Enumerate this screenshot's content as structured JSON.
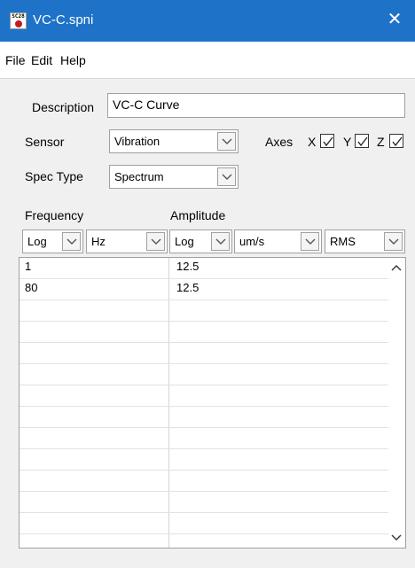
{
  "window": {
    "title": "VC-C.spni",
    "icon_label": "SC28",
    "close_glyph": "✕"
  },
  "menu": {
    "items": [
      "File",
      "Edit",
      "Help"
    ]
  },
  "form": {
    "description_label": "Description",
    "description_value": "VC-C Curve",
    "sensor_label": "Sensor",
    "sensor_value": "Vibration",
    "axes_label": "Axes",
    "axes": [
      {
        "label": "X",
        "checked": true
      },
      {
        "label": "Y",
        "checked": true
      },
      {
        "label": "Z",
        "checked": true
      }
    ],
    "spec_type_label": "Spec Type",
    "spec_type_value": "Spectrum"
  },
  "table": {
    "frequency_header": "Frequency",
    "amplitude_header": "Amplitude",
    "freq_scale": "Log",
    "freq_unit": "Hz",
    "amp_scale": "Log",
    "amp_unit": "um/s",
    "amp_type": "RMS",
    "rows": [
      {
        "frequency": "1",
        "amplitude": "12.5"
      },
      {
        "frequency": "80",
        "amplitude": "12.5"
      }
    ],
    "empty_row_count": 11
  },
  "icons": {
    "app": "spectrum-app-icon",
    "close": "close-icon",
    "dropdown": "chevron-down-icon",
    "check": "checkmark-icon",
    "scroll_up": "scroll-up-icon",
    "scroll_down": "scroll-down-icon"
  },
  "colors": {
    "titlebar": "#1e73c8",
    "panel": "#f0f0f0",
    "app_icon_dot": "#c8191e"
  }
}
